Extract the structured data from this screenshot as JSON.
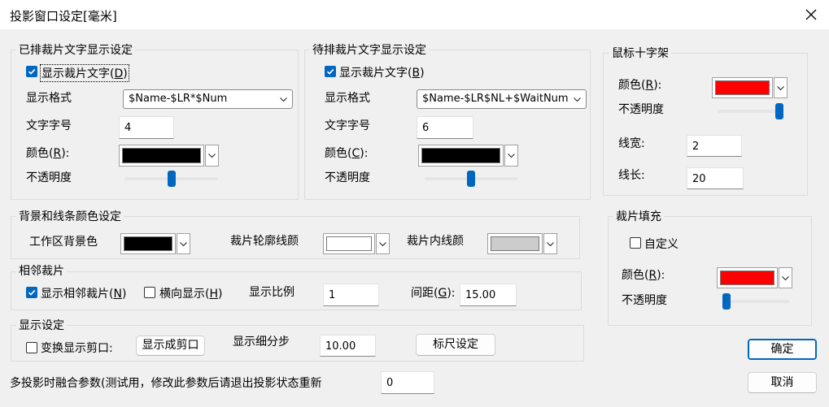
{
  "window": {
    "title": "投影窗口设定[毫米]",
    "close_icon": "close-icon"
  },
  "arranged": {
    "legend": "已排裁片文字显示设定",
    "show_text": {
      "label": "显示裁片文字(",
      "key": "D",
      "suffix": ")",
      "checked": true
    },
    "format_label": "显示格式",
    "format_value": "$Name-$LR*$Num",
    "size_label": "文字字号",
    "size_value": "4",
    "color_label": "颜色(",
    "color_key": "R",
    "color_suffix": "):",
    "color_value": "#000000",
    "opacity_label": "不透明度",
    "opacity_level": 0.5
  },
  "pending": {
    "legend": "待排裁片文字显示设定",
    "show_text": {
      "label": "显示裁片文字(",
      "key": "B",
      "suffix": ")",
      "checked": true
    },
    "format_label": "显示格式",
    "format_value": "$Name-$LR$NL+$WaitNum",
    "size_label": "文字字号",
    "size_value": "6",
    "color_label": "颜色(",
    "color_key": "C",
    "color_suffix": "):",
    "color_value": "#000000",
    "opacity_label": "不透明度",
    "opacity_level": 0.5
  },
  "crosshair": {
    "legend": "鼠标十字架",
    "color_label": "颜色(",
    "color_key": "R",
    "color_suffix": "):",
    "color_value": "#ff0000",
    "opacity_label": "不透明度",
    "opacity_level": 1.0,
    "width_label": "线宽:",
    "width_value": "2",
    "length_label": "线长:",
    "length_value": "20"
  },
  "background": {
    "legend": "背景和线条颜色设定",
    "workspace_label": "工作区背景色",
    "workspace_color": "#000000",
    "outline_label": "裁片轮廓线颜",
    "outline_color": "#ffffff",
    "inner_label": "裁片内线颜",
    "inner_color": "#cccccc"
  },
  "adjacent": {
    "legend": "相邻裁片",
    "show_label": "显示相邻裁片(",
    "show_key": "N",
    "show_suffix": ")",
    "show_checked": true,
    "horizontal_label": "横向显示(",
    "horizontal_key": "H",
    "horizontal_suffix": ")",
    "horizontal_checked": false,
    "ratio_label": "显示比例",
    "ratio_value": "1",
    "spacing_label": "间距(",
    "spacing_key": "G",
    "spacing_suffix": "):",
    "spacing_value": "15.00"
  },
  "fill": {
    "legend": "裁片填充",
    "custom_label": "自定义",
    "custom_checked": false,
    "color_label": "颜色(",
    "color_key": "R",
    "color_suffix": "):",
    "color_value": "#ff0000",
    "opacity_label": "不透明度",
    "opacity_level": 0.0
  },
  "display": {
    "legend": "显示设定",
    "transform_label": "变换显示剪口:",
    "transform_checked": false,
    "to_notch_button": "显示成剪口",
    "subdiv_label": "显示细分步",
    "subdiv_value": "10.00",
    "ruler_button": "标尺设定"
  },
  "blend": {
    "label": "多投影时融合参数(测试用，修改此参数后请退出投影状态重新",
    "value": "0"
  },
  "buttons": {
    "ok": "确定",
    "cancel": "取消"
  }
}
